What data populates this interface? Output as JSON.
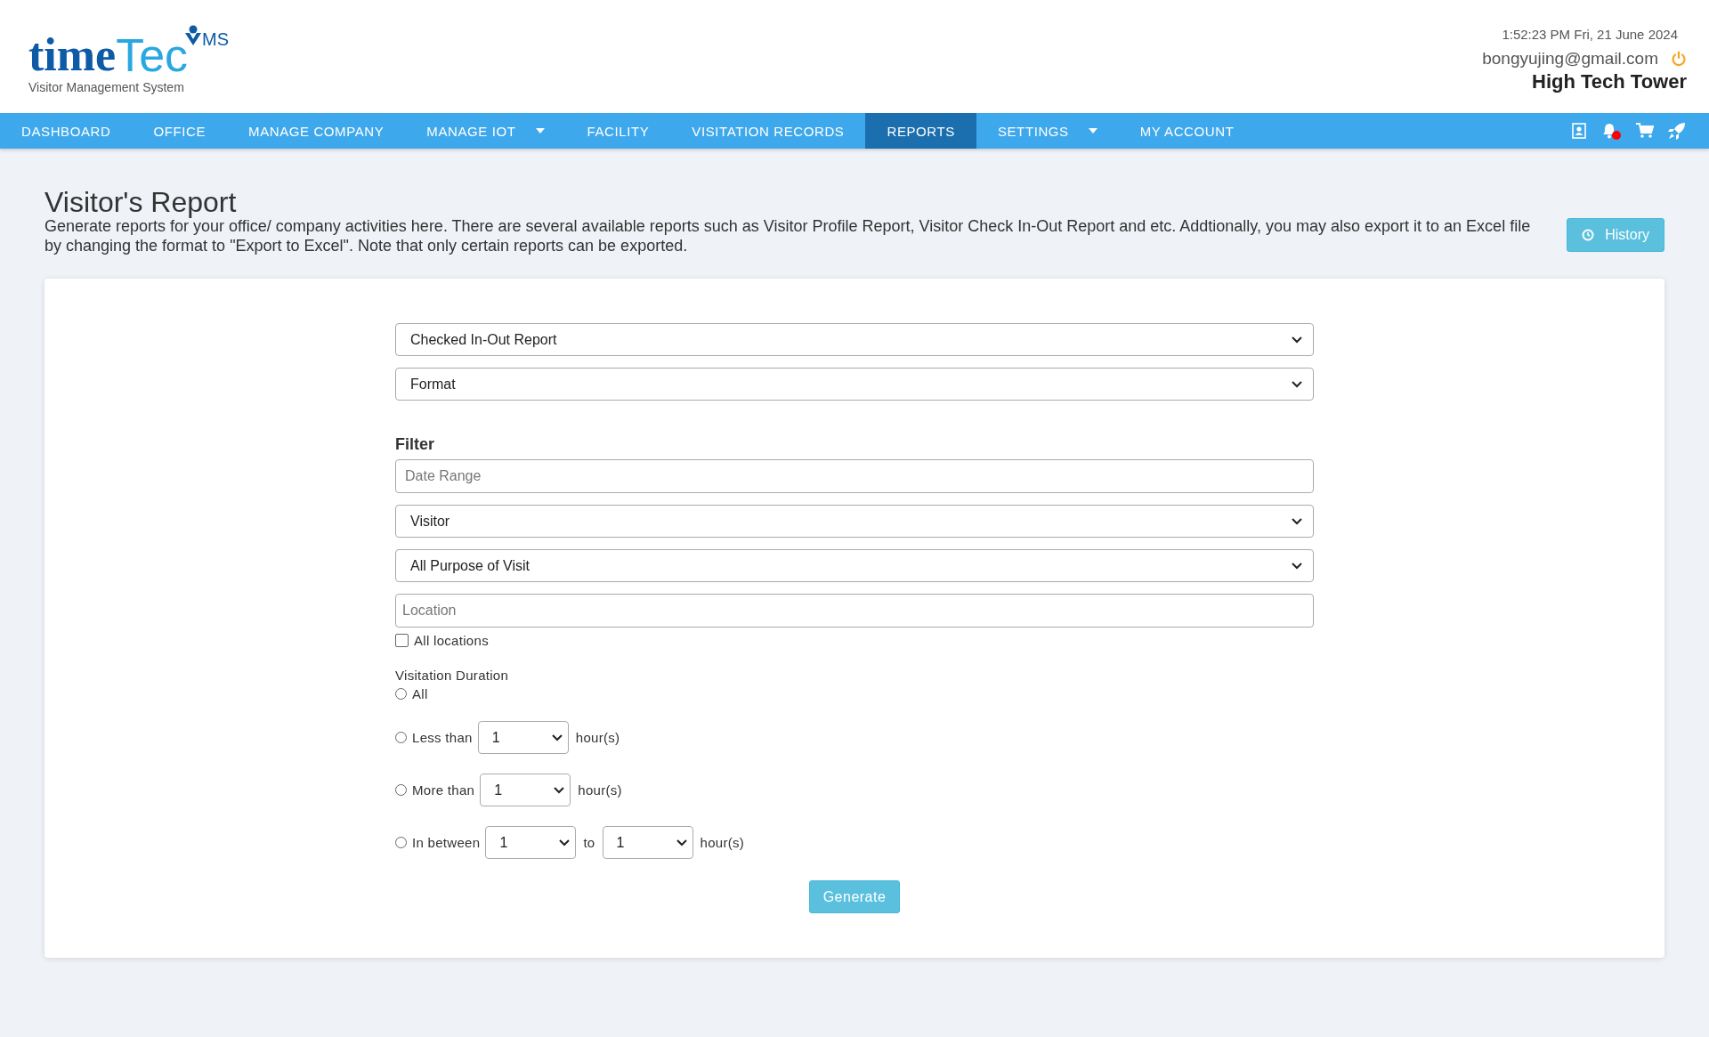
{
  "logo": {
    "word_dark": "time",
    "word_light": "Tec",
    "badge": "MS",
    "tagline": "Visitor Management System"
  },
  "header": {
    "datetime": "1:52:23 PM  Fri, 21 June 2024",
    "email": "bongyujing@gmail.com",
    "site": "High Tech Tower"
  },
  "nav": [
    {
      "label": "DASHBOARD",
      "selected": false,
      "dropdown": false
    },
    {
      "label": "OFFICE",
      "selected": false,
      "dropdown": false
    },
    {
      "label": "MANAGE COMPANY",
      "selected": false,
      "dropdown": false
    },
    {
      "label": "MANAGE IOT",
      "selected": false,
      "dropdown": true
    },
    {
      "label": "FACILITY",
      "selected": false,
      "dropdown": false
    },
    {
      "label": "VISITATION RECORDS",
      "selected": false,
      "dropdown": false
    },
    {
      "label": "REPORTS",
      "selected": true,
      "dropdown": false
    },
    {
      "label": "SETTINGS",
      "selected": false,
      "dropdown": true
    },
    {
      "label": "MY ACCOUNT",
      "selected": false,
      "dropdown": false
    }
  ],
  "notifications": {
    "unread": true
  },
  "page": {
    "title": "Visitor's Report",
    "description": "Generate reports for your office/ company activities here. There are several available reports such as Visitor Profile Report, Visitor Check In-Out Report and etc. Addtionally, you may also export it to an Excel file by changing the format to \"Export to Excel\". Note that only certain reports can be exported.",
    "history_button": "History"
  },
  "form": {
    "report_type": "Checked In-Out Report",
    "format": "Format",
    "filter_label": "Filter",
    "date_range": {
      "placeholder": "Date Range"
    },
    "visitor": "Visitor",
    "purpose": "All Purpose of Visit",
    "location": {
      "placeholder": "Location"
    },
    "all_locations": {
      "label": "All locations",
      "checked": false
    },
    "duration_label": "Visitation Duration",
    "durations": [
      {
        "label": "All",
        "selected": false
      },
      {
        "label": "Less than",
        "selected": false,
        "parts": [
          {
            "kind": "select",
            "text": "1"
          },
          {
            "kind": "text",
            "text": "hour(s)"
          }
        ]
      },
      {
        "label": "More than",
        "selected": false,
        "parts": [
          {
            "kind": "select",
            "text": "1"
          },
          {
            "kind": "text",
            "text": "hour(s)"
          }
        ]
      },
      {
        "label": "In between",
        "selected": false,
        "parts": [
          {
            "kind": "select",
            "text": "1"
          },
          {
            "kind": "text",
            "text": "to"
          },
          {
            "kind": "select",
            "text": "1"
          },
          {
            "kind": "text",
            "text": "hour(s)"
          }
        ]
      }
    ],
    "generate_button": "Generate"
  }
}
